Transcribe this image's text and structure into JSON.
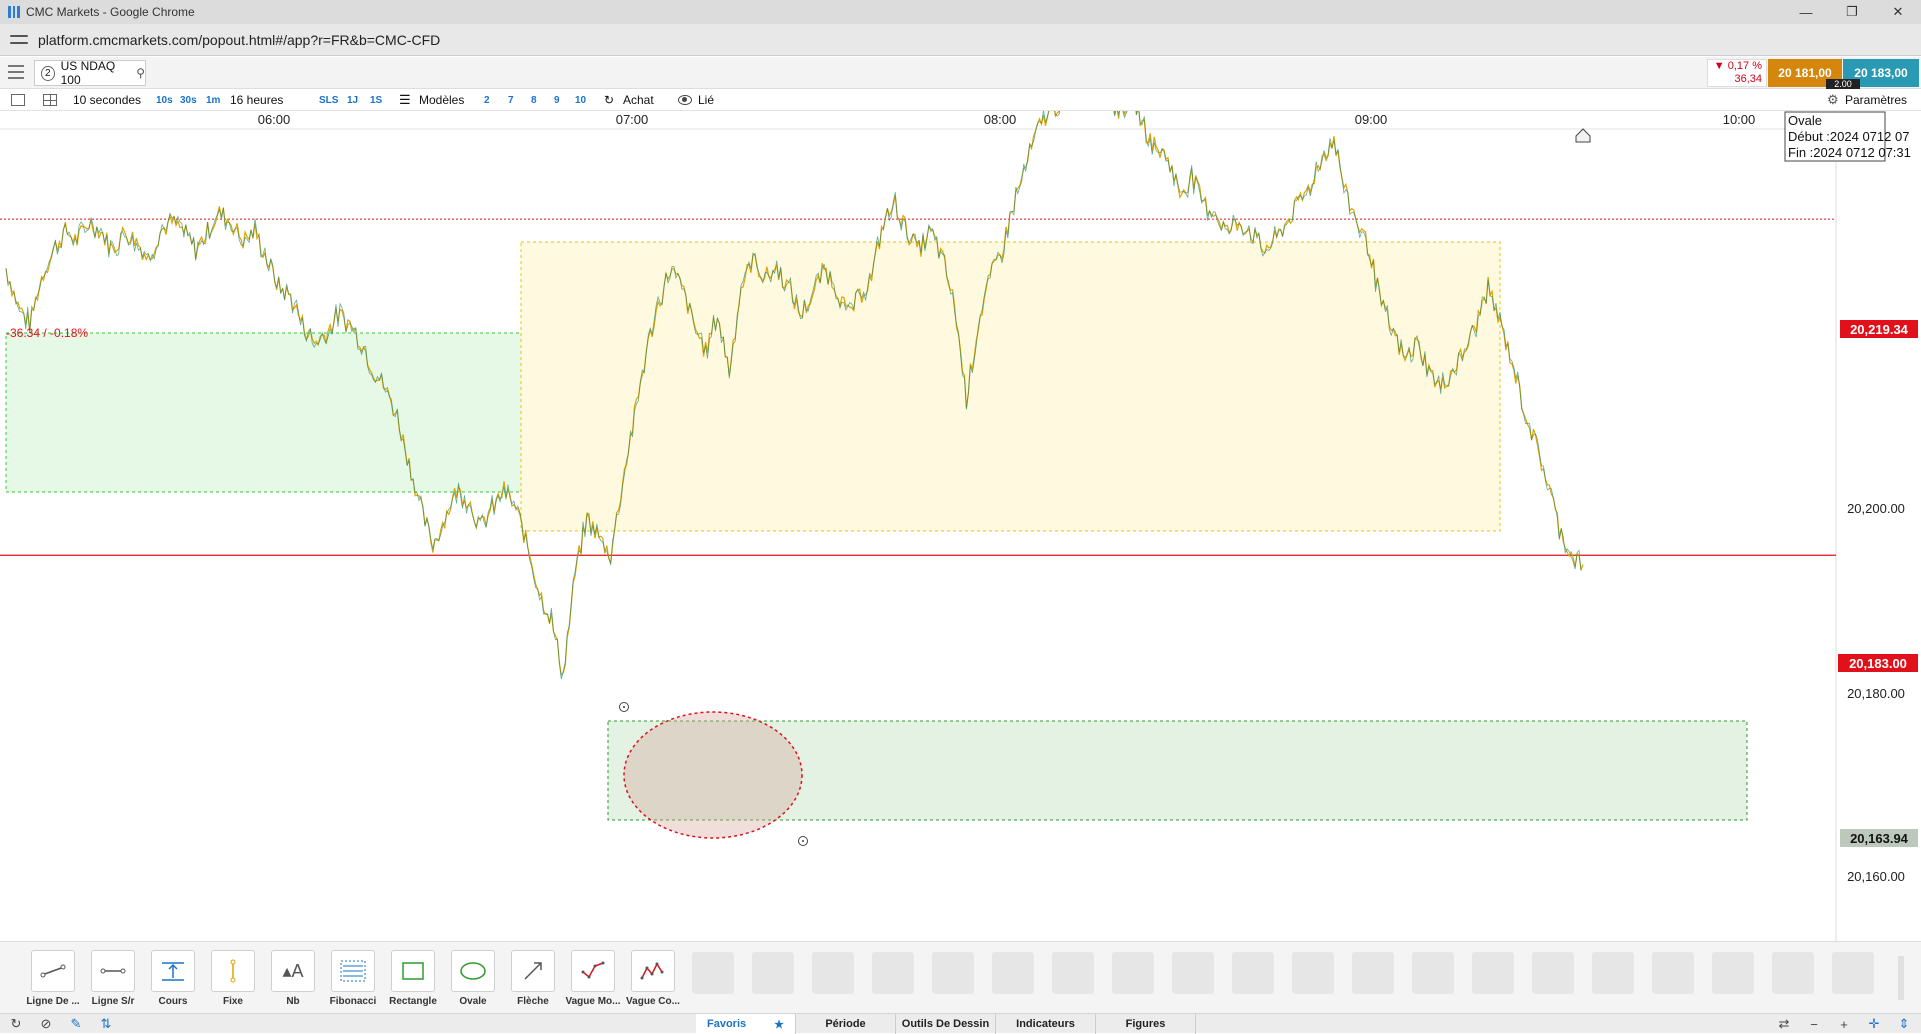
{
  "window": {
    "title": "CMC Markets - Google Chrome",
    "controls": [
      "—",
      "❐",
      "✕"
    ]
  },
  "browser": {
    "url": "platform.cmcmarkets.com/popout.html#/app?r=FR&b=CMC-CFD"
  },
  "instrument": {
    "number": "2",
    "name": "US NDAQ 100",
    "change_pct": "▼ 0,17 %",
    "change_pts": "36,34",
    "sell": "20 181,00",
    "buy": "20 183,00",
    "spread": "2.00"
  },
  "toolbar": {
    "interval": "10 secondes",
    "quick_intervals": [
      "10s",
      "30s",
      "1m"
    ],
    "duration": "16 heures",
    "sls": "SLS",
    "quick_durations": [
      "1J",
      "1S"
    ],
    "models": "Modèles",
    "numbers": [
      "2",
      "7",
      "8",
      "9",
      "10"
    ],
    "buy_label": "Achat",
    "linked": "Lié",
    "settings": "Paramètres"
  },
  "chart_data": {
    "type": "line",
    "x_ticks": [
      "06:00",
      "07:00",
      "08:00",
      "09:00",
      "10:00"
    ],
    "y_ticks": [
      "20,200.00",
      "20,180.00",
      "20,160.00"
    ],
    "ylim": [
      20155,
      20245
    ],
    "series": [
      {
        "values": [
          20214,
          20210,
          20208,
          20213,
          20216,
          20218,
          20217,
          20219,
          20218,
          20216,
          20218,
          20217,
          20215,
          20218,
          20219,
          20218,
          20216,
          20218,
          20220,
          20219,
          20217,
          20218,
          20215,
          20212,
          20211,
          20208,
          20206,
          20207,
          20209,
          20208,
          20206,
          20203,
          20201,
          20198,
          20193,
          20188,
          20184,
          20187,
          20190,
          20189,
          20186,
          20188,
          20190,
          20188,
          20184,
          20179,
          20176,
          20170,
          20181,
          20187,
          20185,
          20183,
          20191,
          20198,
          20205,
          20210,
          20214,
          20212,
          20208,
          20205,
          20209,
          20203,
          20212,
          20215,
          20213,
          20214,
          20212,
          20209,
          20211,
          20214,
          20212,
          20209,
          20211,
          20213,
          20219,
          20221,
          20218,
          20216,
          20218,
          20215,
          20210,
          20200,
          20208,
          20213,
          20216,
          20221,
          20225,
          20229,
          20231,
          20232,
          20234,
          20236,
          20235,
          20232,
          20231,
          20233,
          20229,
          20227,
          20226,
          20222,
          20224,
          20221,
          20220,
          20218,
          20219,
          20218,
          20216,
          20217,
          20219,
          20221,
          20223,
          20226,
          20228,
          20222,
          20219,
          20216,
          20210,
          20207,
          20204,
          20206,
          20203,
          20201,
          20203,
          20205,
          20208,
          20212,
          20208,
          20204,
          20199,
          20195,
          20191,
          20186,
          20183,
          20182
        ]
      }
    ],
    "reference_lines": [
      {
        "label": "-36.34 / -0.18%",
        "value": 20219.34,
        "tag": "20,219.34",
        "color": "#e0111a",
        "style": "dotted"
      },
      {
        "value": 20183.0,
        "tag": "20,183.00",
        "color": "#e0111a",
        "style": "solid"
      }
    ],
    "highlight_tag": "20,163.94",
    "annotation": {
      "title": "Ovale",
      "start": "Début :2024 0712 07",
      "end": "Fin :2024 0712 07:31"
    },
    "zones": [
      {
        "color": "#e6f9e6",
        "border": "#33cc33"
      },
      {
        "color": "#fff9e0",
        "border": "#f0c400"
      },
      {
        "color": "#e3f2e3",
        "border": "#2d9b2d"
      }
    ]
  },
  "tools": [
    "Ligne De ...",
    "Ligne S/r",
    "Cours",
    "Fixe",
    "Nb",
    "Fibonacci",
    "Rectangle",
    "Ovale",
    "Flèche",
    "Vague Mo...",
    "Vague Co..."
  ],
  "bottom_tabs": [
    "Favoris",
    "Période",
    "Outils De Dessin",
    "Indicateurs",
    "Figures"
  ]
}
